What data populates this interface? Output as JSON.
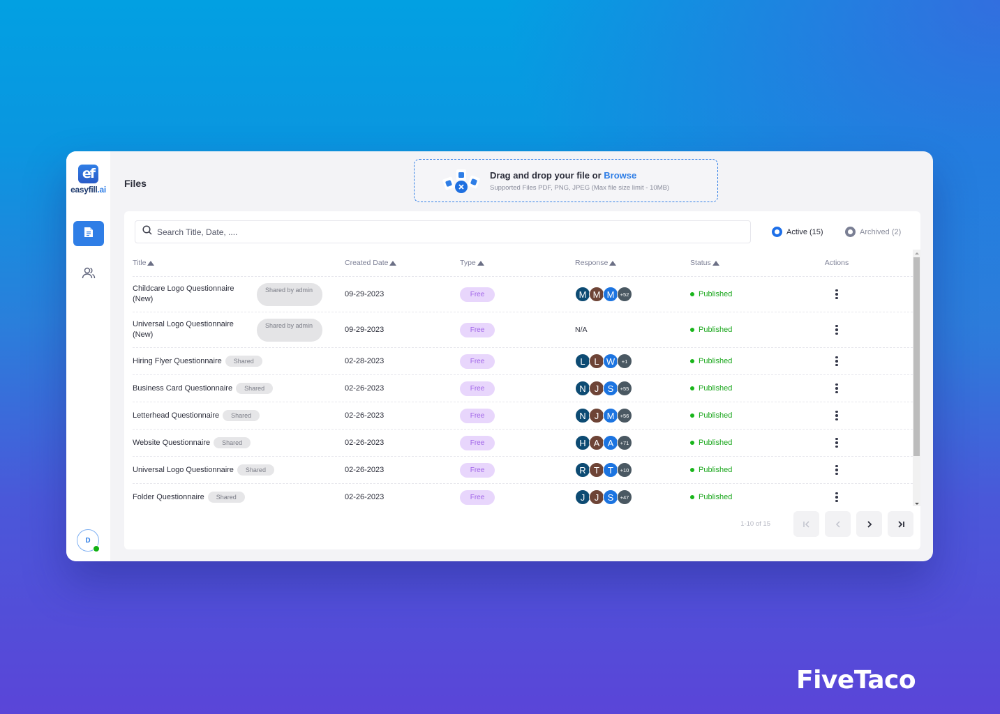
{
  "app": {
    "logo_mark": "ef",
    "logo_name": "easyfill",
    "logo_suffix": ".ai",
    "page_title": "Files"
  },
  "sidebar": {
    "items": [
      {
        "name": "files",
        "icon": "document-icon",
        "active": true
      },
      {
        "name": "users",
        "icon": "users-icon",
        "active": false
      }
    ],
    "user_initial": "D",
    "user_status": "online"
  },
  "upload": {
    "title": "Drag and drop your file or ",
    "browse_label": "Browse",
    "subtitle": "Supported Files PDF, PNG, JPEG (Max file size limit - 10MB)"
  },
  "search": {
    "placeholder": "Search Title, Date, ....",
    "value": ""
  },
  "filters": {
    "active_label": "Active (15)",
    "archived_label": "Archived (2)",
    "selected": "active"
  },
  "table": {
    "columns": [
      "Title",
      "Created Date",
      "Type",
      "Response",
      "Status",
      "Actions"
    ],
    "rows": [
      {
        "title": "Childcare Logo Questionnaire (New)",
        "badge": "Shared by admin",
        "date": "09-29-2023",
        "type": "Free",
        "responses": [
          "M",
          "M",
          "M"
        ],
        "more": "+52",
        "status": "Published"
      },
      {
        "title": "Universal Logo Questionnaire (New)",
        "badge": "Shared by admin",
        "date": "09-29-2023",
        "type": "Free",
        "responses": [],
        "more": "",
        "na": "N/A",
        "status": "Published"
      },
      {
        "title": "Hiring Flyer Questionnaire",
        "badge": "Shared",
        "date": "02-28-2023",
        "type": "Free",
        "responses": [
          "L",
          "L",
          "W"
        ],
        "more": "+1",
        "status": "Published"
      },
      {
        "title": "Business Card Questionnaire",
        "badge": "Shared",
        "date": "02-26-2023",
        "type": "Free",
        "responses": [
          "N",
          "J",
          "S"
        ],
        "more": "+55",
        "status": "Published"
      },
      {
        "title": "Letterhead Questionnaire",
        "badge": "Shared",
        "date": "02-26-2023",
        "type": "Free",
        "responses": [
          "N",
          "J",
          "M"
        ],
        "more": "+56",
        "status": "Published"
      },
      {
        "title": "Website Questionnaire",
        "badge": "Shared",
        "date": "02-26-2023",
        "type": "Free",
        "responses": [
          "H",
          "A",
          "A"
        ],
        "more": "+71",
        "status": "Published"
      },
      {
        "title": "Universal Logo Questionnaire",
        "badge": "Shared",
        "date": "02-26-2023",
        "type": "Free",
        "responses": [
          "R",
          "T",
          "T"
        ],
        "more": "+10",
        "status": "Published"
      },
      {
        "title": "Folder Questionnaire",
        "badge": "Shared",
        "date": "02-26-2023",
        "type": "Free",
        "responses": [
          "J",
          "J",
          "S"
        ],
        "more": "+47",
        "status": "Published"
      }
    ]
  },
  "pagination": {
    "info": "1-10 of 15",
    "buttons": [
      "first",
      "previous",
      "next",
      "last"
    ]
  },
  "colors": {
    "accent": "#2f7ee6",
    "published": "#19a61b",
    "type_badge_bg": "#e8d6fc",
    "type_badge_text": "#a064e8"
  },
  "watermark": "FiveTaco"
}
